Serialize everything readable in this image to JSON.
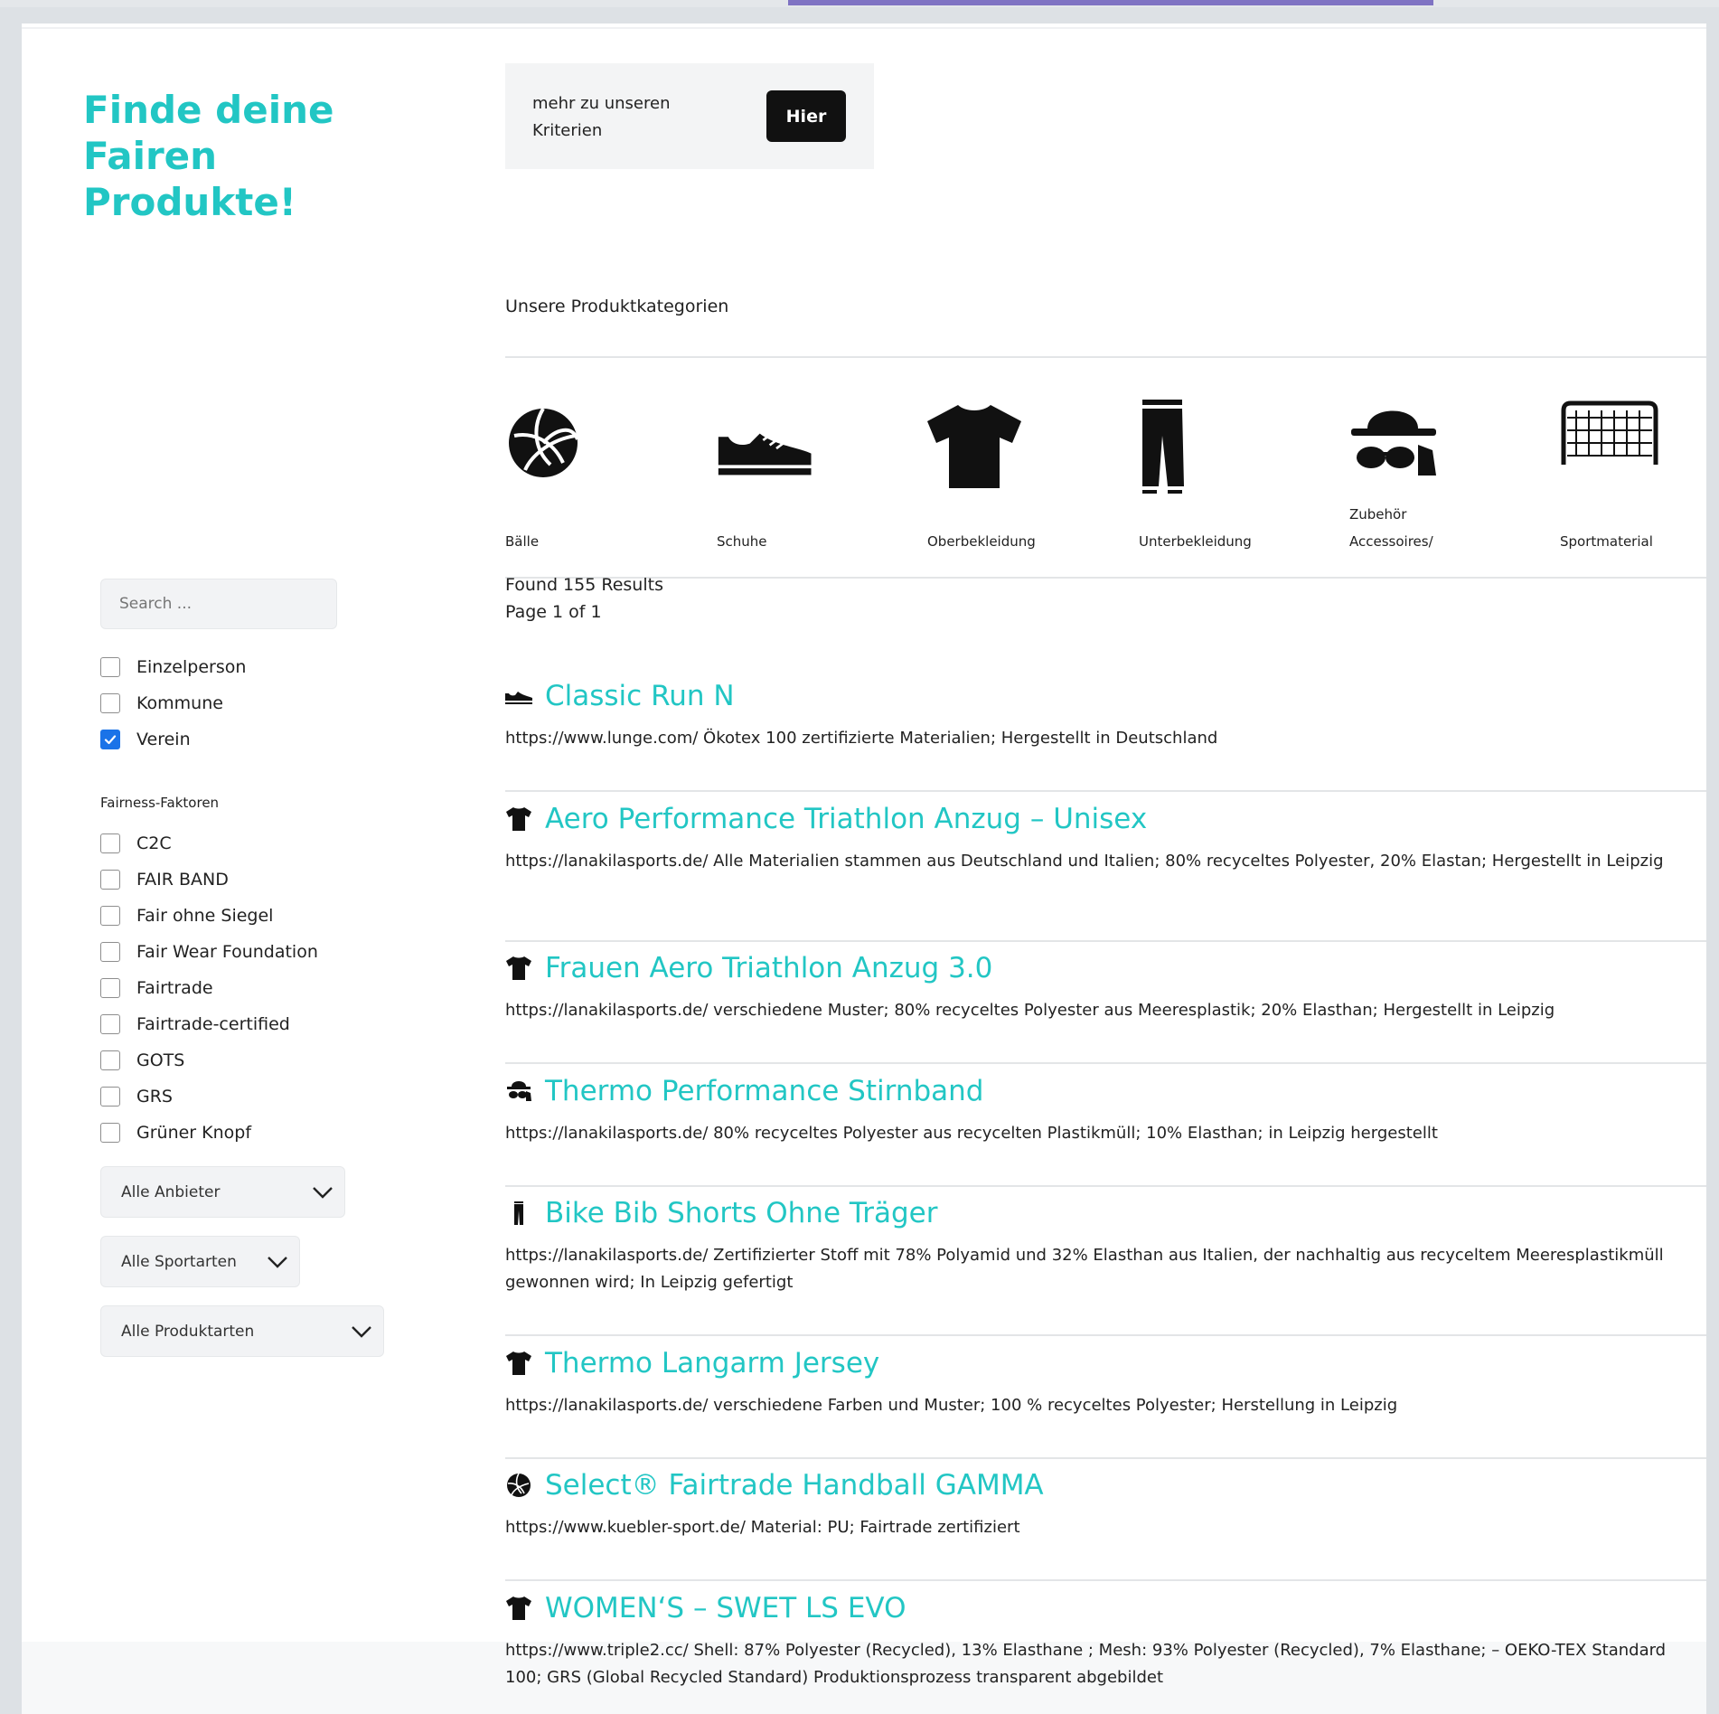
{
  "sidebar": {
    "headline": "Finde deine Fairen Produkte!",
    "search_placeholder": "Search ...",
    "target_groups": [
      {
        "label": "Einzelperson",
        "checked": false
      },
      {
        "label": "Kommune",
        "checked": false
      },
      {
        "label": "Verein",
        "checked": true
      }
    ],
    "fairness_title": "Fairness-Faktoren",
    "fairness": [
      {
        "label": "C2C",
        "checked": false
      },
      {
        "label": "FAIR BAND",
        "checked": false
      },
      {
        "label": "Fair ohne Siegel",
        "checked": false
      },
      {
        "label": "Fair Wear Foundation",
        "checked": false
      },
      {
        "label": "Fairtrade",
        "checked": false
      },
      {
        "label": "Fairtrade-certified",
        "checked": false
      },
      {
        "label": "GOTS",
        "checked": false
      },
      {
        "label": "GRS",
        "checked": false
      },
      {
        "label": "Grüner Knopf",
        "checked": false
      }
    ],
    "selects": {
      "anbieter": "Alle Anbieter",
      "sportarten": "Alle Sportarten",
      "produktarten": "Alle Produktarten"
    }
  },
  "info": {
    "text": "mehr zu unseren Kriterien",
    "button": "Hier"
  },
  "categories": {
    "title": "Unsere Produktkategorien",
    "items": [
      {
        "label": "Bälle",
        "icon": "ball-icon"
      },
      {
        "label": "Schuhe",
        "icon": "shoe-icon"
      },
      {
        "label": "Oberbekleidung",
        "icon": "tshirt-icon"
      },
      {
        "label": "Unterbekleidung",
        "icon": "pants-icon"
      },
      {
        "label_top": "Zubehör",
        "label": "Accessoires/",
        "icon": "accessories-icon"
      },
      {
        "label": "Sportmaterial",
        "icon": "goal-icon"
      }
    ]
  },
  "results": {
    "found": "Found 155 Results",
    "page": "Page 1 of 1",
    "items": [
      {
        "title": "Classic Run N",
        "icon": "shoe-icon",
        "desc": "https://www.lunge.com/ Ökotex 100 zertifizierte Materialien; Hergestellt in Deutschland"
      },
      {
        "title": "Aero Performance Triathlon Anzug – Unisex",
        "icon": "tshirt-icon",
        "desc": "https://lanakilasports.de/ Alle Materialien stammen aus Deutschland und Italien; 80% recyceltes Polyester, 20% Elastan; Hergestellt in Leipzig"
      },
      {
        "title": "Frauen Aero Triathlon Anzug 3.0",
        "icon": "tshirt-icon",
        "desc": "https://lanakilasports.de/ verschiedene Muster; 80% recyceltes Polyester aus Meeresplastik; 20% Elasthan; Hergestellt in Leipzig"
      },
      {
        "title": "Thermo Performance Stirnband",
        "icon": "accessories-icon",
        "desc": "https://lanakilasports.de/ 80% recyceltes Polyester aus recycelten Plastikmüll; 10% Elasthan; in Leipzig hergestellt"
      },
      {
        "title": "Bike Bib Shorts Ohne Träger",
        "icon": "pants-icon",
        "desc": "https://lanakilasports.de/ Zertifizierter Stoff mit 78% Polyamid und 32% Elasthan aus Italien, der nachhaltig aus recyceltem Meeresplastikmüll gewonnen wird; In Leipzig gefertigt"
      },
      {
        "title": "Thermo Langarm Jersey",
        "icon": "tshirt-icon",
        "desc": "https://lanakilasports.de/ verschiedene Farben und Muster; 100 % recyceltes Polyester; Herstellung in Leipzig"
      },
      {
        "title": "Select® Fairtrade Handball GAMMA",
        "icon": "ball-icon",
        "desc": "https://www.kuebler-sport.de/ Material: PU; Fairtrade zertifiziert"
      },
      {
        "title": "WOMEN‘S – SWET LS EVO",
        "icon": "tshirt-icon",
        "desc": "https://www.triple2.cc/ Shell: 87% Polyester (Recycled), 13% Elasthane ; Mesh: 93% Polyester (Recycled), 7% Elasthane; – OEKO-TEX Standard 100; GRS (Global Recycled Standard) Produktionsprozess transparent abgebildet"
      }
    ]
  },
  "colors": {
    "accent": "#22c6c4",
    "checkbox": "#1a73e8",
    "topbar": "#7f73c3"
  }
}
